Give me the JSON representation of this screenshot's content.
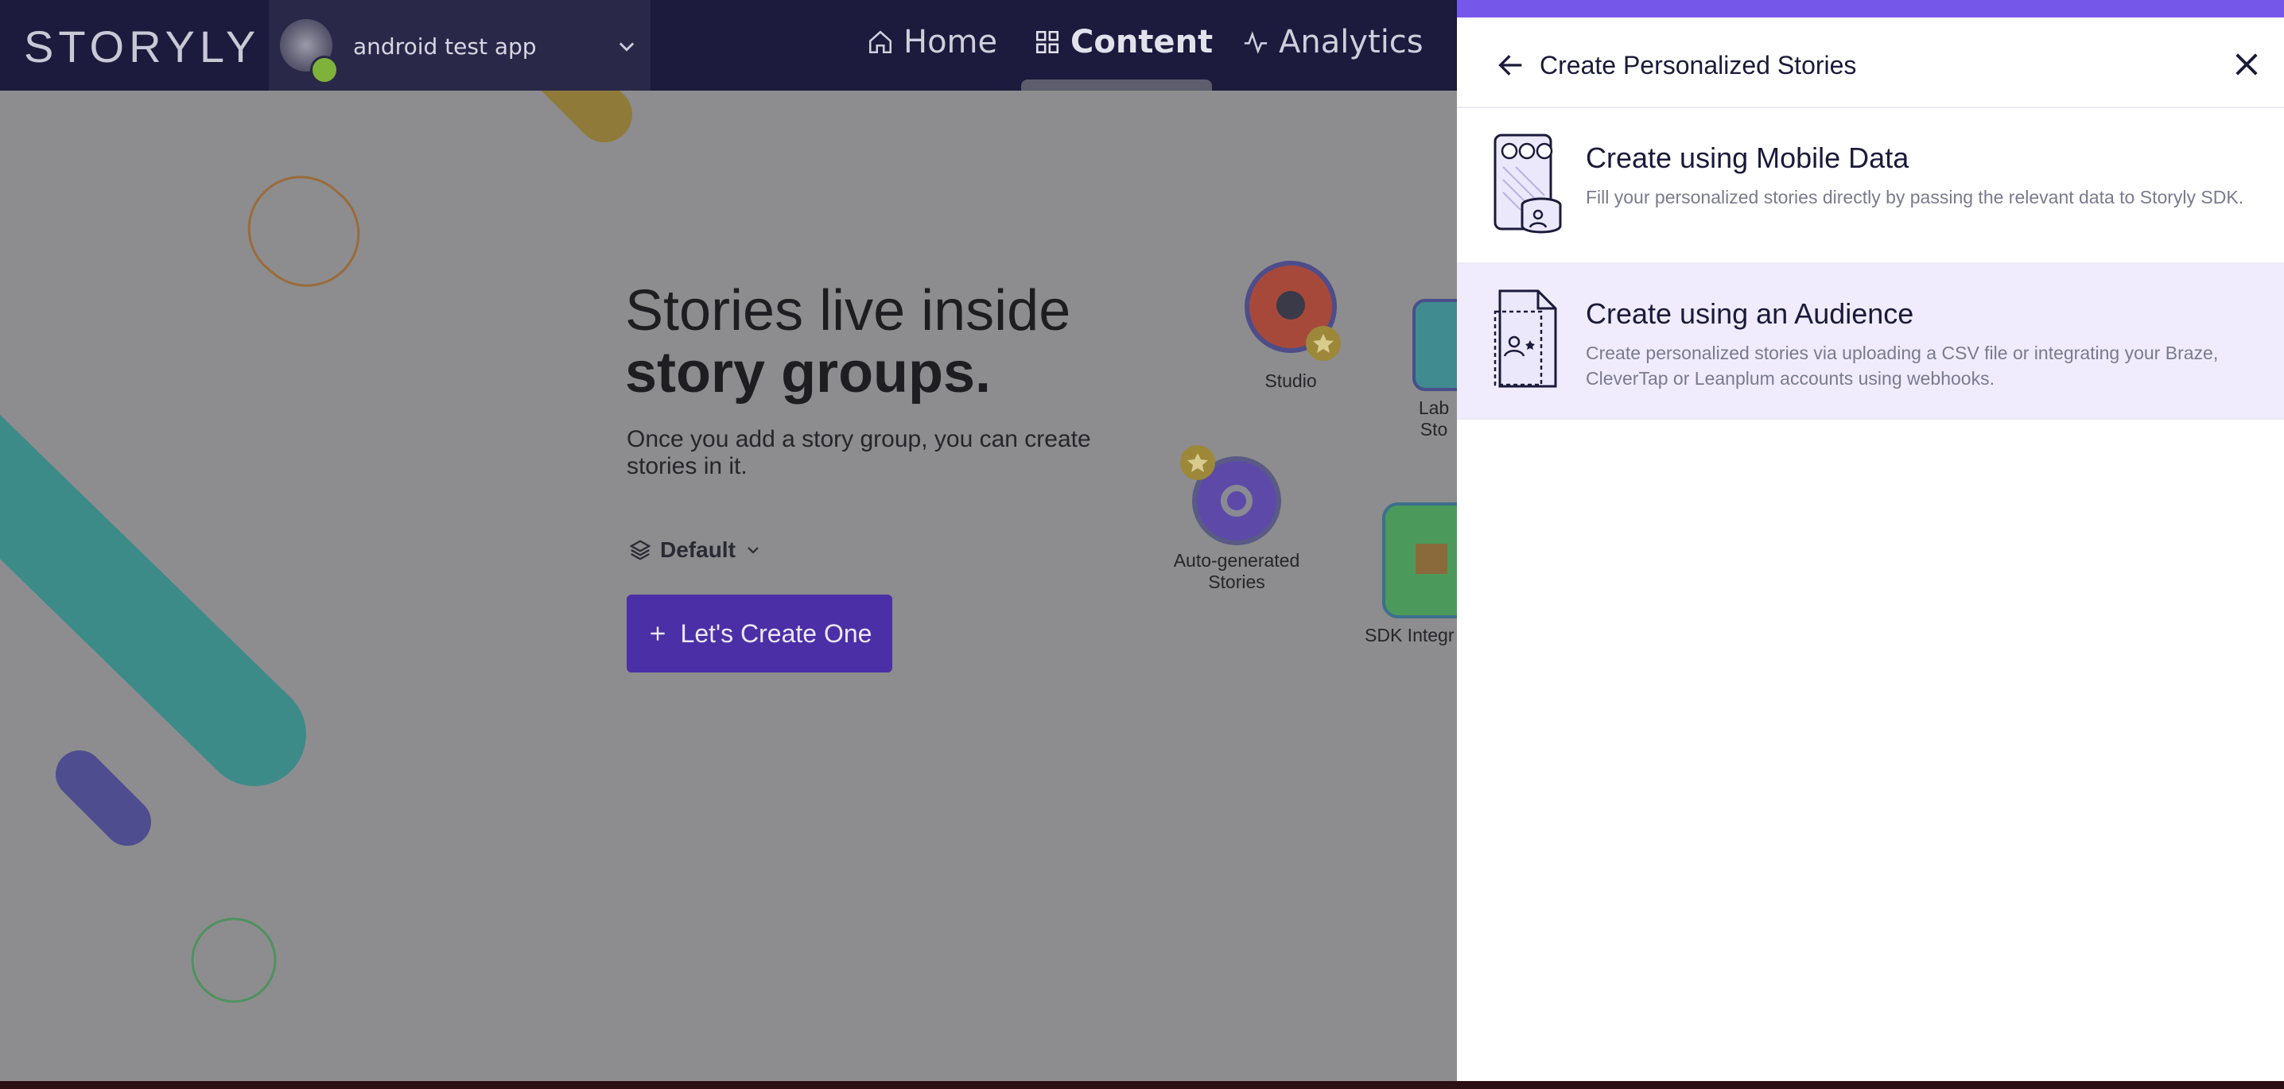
{
  "topbar": {
    "logo": "STORYLY",
    "app_name": "android test app",
    "nav": [
      {
        "label": "Home",
        "icon": "home-icon"
      },
      {
        "label": "Content",
        "icon": "grid-icon"
      },
      {
        "label": "Analytics",
        "icon": "pulse-icon"
      }
    ]
  },
  "hero": {
    "title_line1": "Stories live inside",
    "title_line2": "story groups.",
    "subtitle": "Once you add a story group, you can create stories in it.",
    "default_label": "Default",
    "cta_label": "Let's Create One"
  },
  "stories": [
    {
      "label": "Studio"
    },
    {
      "label": "Auto-generated Stories"
    },
    {
      "label": "Lab Sto"
    },
    {
      "label": "SDK Integr"
    }
  ],
  "panel": {
    "title": "Create Personalized Stories",
    "options": [
      {
        "title": "Create using Mobile Data",
        "description": "Fill your personalized stories directly by passing the relevant data to Storyly SDK."
      },
      {
        "title": "Create using an Audience",
        "description": "Create personalized stories via uploading a CSV file or integrating your Braze, CleverTap or Leanplum accounts using webhooks."
      }
    ]
  },
  "colors": {
    "topbar": "#1c1a3d",
    "accent": "#7558ea",
    "cta": "#4b2fa6",
    "selected_option_bg": "#f0ecfd"
  }
}
